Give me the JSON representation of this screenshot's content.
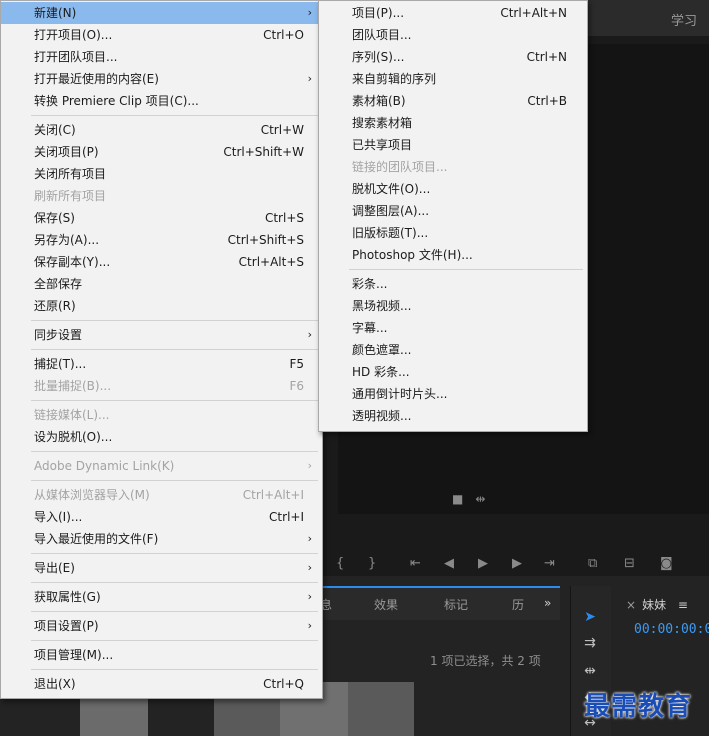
{
  "background": {
    "learn_label": "学习",
    "panel_tabs": [
      "息",
      "效果",
      "标记",
      "历"
    ],
    "panel_more": "»",
    "selection_info": "1 项已选择，共 2 项",
    "sequence_tab": "妹妹",
    "sequence_menu": "≡",
    "timecode": "00:00:00:0",
    "watermark": "最需教育"
  },
  "file_menu": {
    "items": [
      {
        "label": "新建(N)",
        "submenu": true,
        "highlight": true
      },
      {
        "label": "打开项目(O)...",
        "shortcut": "Ctrl+O"
      },
      {
        "label": "打开团队项目..."
      },
      {
        "label": "打开最近使用的内容(E)",
        "submenu": true
      },
      {
        "label": "转换 Premiere Clip 项目(C)..."
      },
      {
        "separator": true
      },
      {
        "label": "关闭(C)",
        "shortcut": "Ctrl+W"
      },
      {
        "label": "关闭项目(P)",
        "shortcut": "Ctrl+Shift+W"
      },
      {
        "label": "关闭所有项目"
      },
      {
        "label": "刷新所有项目",
        "disabled": true
      },
      {
        "label": "保存(S)",
        "shortcut": "Ctrl+S"
      },
      {
        "label": "另存为(A)...",
        "shortcut": "Ctrl+Shift+S"
      },
      {
        "label": "保存副本(Y)...",
        "shortcut": "Ctrl+Alt+S"
      },
      {
        "label": "全部保存"
      },
      {
        "label": "还原(R)"
      },
      {
        "separator": true
      },
      {
        "label": "同步设置",
        "submenu": true
      },
      {
        "separator": true
      },
      {
        "label": "捕捉(T)...",
        "shortcut": "F5"
      },
      {
        "label": "批量捕捉(B)...",
        "shortcut": "F6",
        "disabled": true
      },
      {
        "separator": true
      },
      {
        "label": "链接媒体(L)...",
        "disabled": true
      },
      {
        "label": "设为脱机(O)..."
      },
      {
        "separator": true
      },
      {
        "label": "Adobe Dynamic Link(K)",
        "submenu": true,
        "disabled": true
      },
      {
        "separator": true
      },
      {
        "label": "从媒体浏览器导入(M)",
        "shortcut": "Ctrl+Alt+I",
        "disabled": true
      },
      {
        "label": "导入(I)...",
        "shortcut": "Ctrl+I"
      },
      {
        "label": "导入最近使用的文件(F)",
        "submenu": true
      },
      {
        "separator": true
      },
      {
        "label": "导出(E)",
        "submenu": true
      },
      {
        "separator": true
      },
      {
        "label": "获取属性(G)",
        "submenu": true
      },
      {
        "separator": true
      },
      {
        "label": "项目设置(P)",
        "submenu": true
      },
      {
        "separator": true
      },
      {
        "label": "项目管理(M)..."
      },
      {
        "separator": true
      },
      {
        "label": "退出(X)",
        "shortcut": "Ctrl+Q"
      }
    ]
  },
  "new_submenu": {
    "items": [
      {
        "label": "项目(P)...",
        "shortcut": "Ctrl+Alt+N"
      },
      {
        "label": "团队项目..."
      },
      {
        "label": "序列(S)...",
        "shortcut": "Ctrl+N"
      },
      {
        "label": "来自剪辑的序列"
      },
      {
        "label": "素材箱(B)",
        "shortcut": "Ctrl+B"
      },
      {
        "label": "搜索素材箱"
      },
      {
        "label": "已共享项目"
      },
      {
        "label": "链接的团队项目...",
        "disabled": true
      },
      {
        "label": "脱机文件(O)..."
      },
      {
        "label": "调整图层(A)..."
      },
      {
        "label": "旧版标题(T)..."
      },
      {
        "label": "Photoshop 文件(H)..."
      },
      {
        "separator": true
      },
      {
        "label": "彩条..."
      },
      {
        "label": "黑场视频..."
      },
      {
        "label": "字幕..."
      },
      {
        "label": "颜色遮罩..."
      },
      {
        "label": "HD 彩条..."
      },
      {
        "label": "通用倒计时片头..."
      },
      {
        "label": "透明视频..."
      }
    ]
  }
}
